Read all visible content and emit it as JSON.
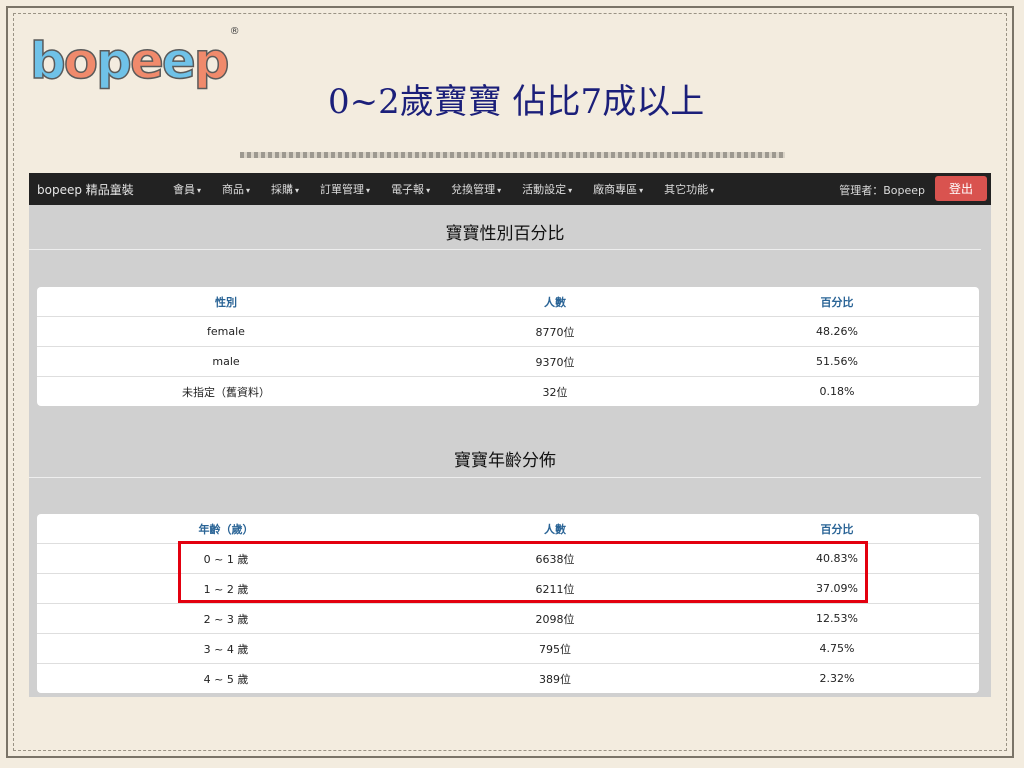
{
  "logo": {
    "letters": [
      {
        "ch": "b",
        "color": "#6fc2e8"
      },
      {
        "ch": "o",
        "color": "#f08a6c"
      },
      {
        "ch": "p",
        "color": "#6fc2e8"
      },
      {
        "ch": "e",
        "color": "#f08a6c"
      },
      {
        "ch": "e",
        "color": "#6fc2e8"
      },
      {
        "ch": "p",
        "color": "#f08a6c"
      }
    ],
    "registered": "®"
  },
  "slide_title": "0~2歲寶寶 佔比7成以上",
  "navbar": {
    "brand": "bopeep 精品童裝",
    "items": [
      "會員",
      "商品",
      "採購",
      "訂單管理",
      "電子報",
      "兌換管理",
      "活動設定",
      "廠商專區",
      "其它功能"
    ],
    "caret": "▾",
    "admin": "管理者：Bopeep",
    "logout": "登出"
  },
  "gender_section": {
    "title": "寶寶性別百分比",
    "headers": [
      "性別",
      "人數",
      "百分比"
    ],
    "rows": [
      [
        "female",
        "8770位",
        "48.26%"
      ],
      [
        "male",
        "9370位",
        "51.56%"
      ],
      [
        "未指定（舊資料）",
        "32位",
        "0.18%"
      ]
    ]
  },
  "age_section": {
    "title": "寶寶年齡分佈",
    "headers": [
      "年齡（歲）",
      "人數",
      "百分比"
    ],
    "rows": [
      [
        "0 ~ 1 歲",
        "6638位",
        "40.83%"
      ],
      [
        "1 ~ 2 歲",
        "6211位",
        "37.09%"
      ],
      [
        "2 ~ 3 歲",
        "2098位",
        "12.53%"
      ],
      [
        "3 ~ 4 歲",
        "795位",
        "4.75%"
      ],
      [
        "4 ~ 5 歲",
        "389位",
        "2.32%"
      ]
    ]
  },
  "colors": {
    "highlight": "#e3000f",
    "navbar_bg": "#222222",
    "logout_bg": "#d9534f",
    "header_text": "#2a6496",
    "title_text": "#1b1f7a"
  }
}
